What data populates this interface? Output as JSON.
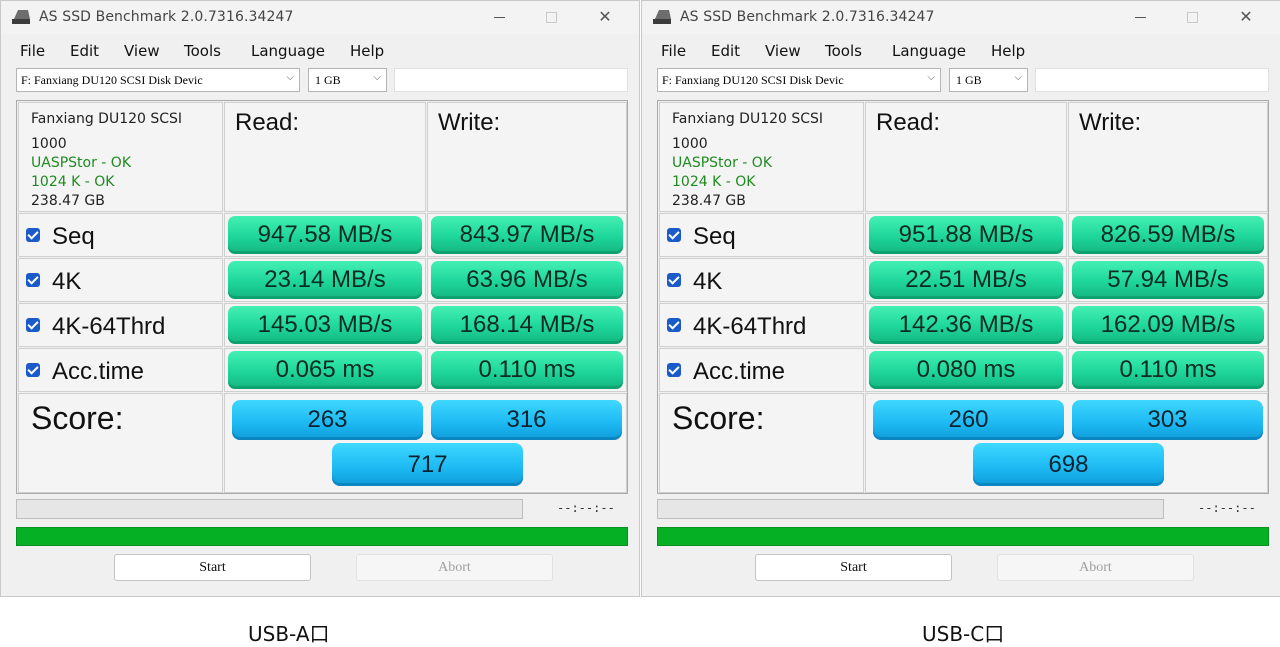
{
  "windows": [
    {
      "title": "AS SSD Benchmark 2.0.7316.34247",
      "menu": [
        "File",
        "Edit",
        "View",
        "Tools",
        "Language",
        "Help"
      ],
      "drive_select": "F: Fanxiang DU120 SCSI Disk Devic",
      "size_select": "1 GB",
      "info": {
        "model": "Fanxiang DU120 SCSI",
        "firmware": "1000",
        "driver_status": "UASPStor - OK",
        "alignment_status": "1024 K - OK",
        "capacity": "238.47 GB"
      },
      "headers": {
        "read": "Read:",
        "write": "Write:"
      },
      "rows": [
        {
          "label": "Seq",
          "read": "947.58 MB/s",
          "write": "843.97 MB/s"
        },
        {
          "label": "4K",
          "read": "23.14 MB/s",
          "write": "63.96 MB/s"
        },
        {
          "label": "4K-64Thrd",
          "read": "145.03 MB/s",
          "write": "168.14 MB/s"
        },
        {
          "label": "Acc.time",
          "read": "0.065 ms",
          "write": "0.110 ms"
        }
      ],
      "score": {
        "label": "Score:",
        "read": "263",
        "write": "316",
        "total": "717"
      },
      "time": "--:--:--",
      "buttons": {
        "start": "Start",
        "abort": "Abort"
      },
      "caption": "USB-A口"
    },
    {
      "title": "AS SSD Benchmark 2.0.7316.34247",
      "menu": [
        "File",
        "Edit",
        "View",
        "Tools",
        "Language",
        "Help"
      ],
      "drive_select": "F: Fanxiang DU120 SCSI Disk Devic",
      "size_select": "1 GB",
      "info": {
        "model": "Fanxiang DU120 SCSI",
        "firmware": "1000",
        "driver_status": "UASPStor - OK",
        "alignment_status": "1024 K - OK",
        "capacity": "238.47 GB"
      },
      "headers": {
        "read": "Read:",
        "write": "Write:"
      },
      "rows": [
        {
          "label": "Seq",
          "read": "951.88 MB/s",
          "write": "826.59 MB/s"
        },
        {
          "label": "4K",
          "read": "22.51 MB/s",
          "write": "57.94 MB/s"
        },
        {
          "label": "4K-64Thrd",
          "read": "142.36 MB/s",
          "write": "162.09 MB/s"
        },
        {
          "label": "Acc.time",
          "read": "0.080 ms",
          "write": "0.110 ms"
        }
      ],
      "score": {
        "label": "Score:",
        "read": "260",
        "write": "303",
        "total": "698"
      },
      "time": "--:--:--",
      "buttons": {
        "start": "Start",
        "abort": "Abort"
      },
      "caption": "USB-C口"
    }
  ]
}
